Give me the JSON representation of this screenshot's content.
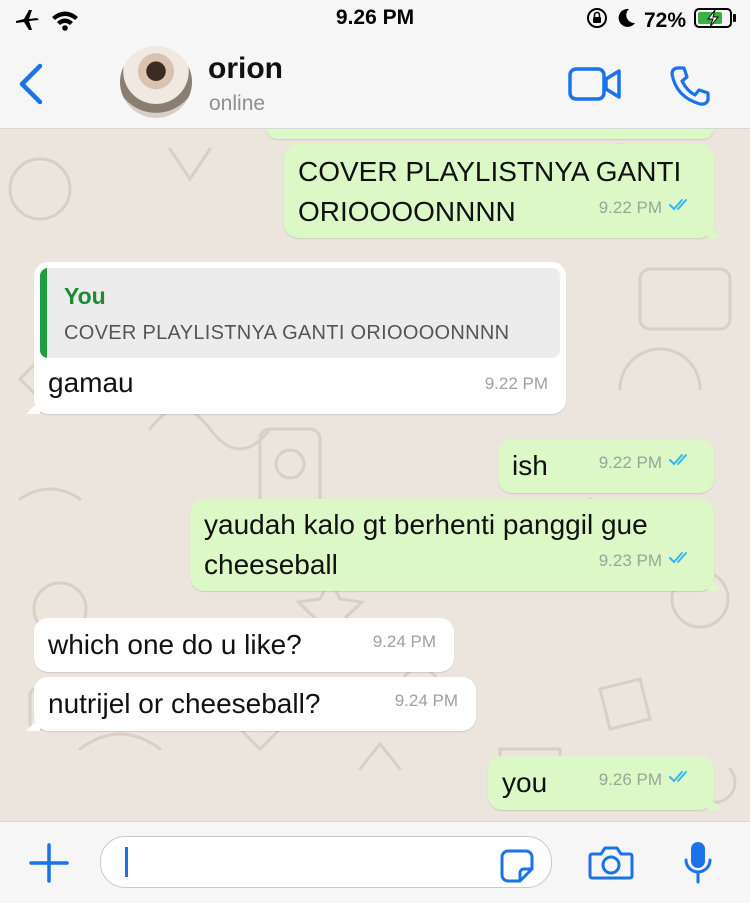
{
  "status_bar": {
    "time": "9.26 PM",
    "battery": "72%",
    "icons": [
      "airplane-icon",
      "wifi-icon",
      "orientation-lock-icon",
      "moon-icon",
      "battery-charging-icon"
    ]
  },
  "header": {
    "contact_name": "orion",
    "contact_status": "online",
    "icons": [
      "chevron-left-icon",
      "video-camera-icon",
      "phone-icon"
    ]
  },
  "colors": {
    "accent": "#1a73e8",
    "outgoing_bubble": "#dcf8c6",
    "incoming_bubble": "#ffffff",
    "read_ticks": "#34b7f1",
    "chat_background": "#ece5dd",
    "quote_author": "#1f8a32"
  },
  "messages": [
    {
      "direction": "out",
      "text": "COVER PLAYLISTNYA GANTI ORIOOOONNNN",
      "time": "9.22 PM",
      "read": true
    },
    {
      "direction": "in",
      "reply_to": {
        "author": "You",
        "text": "COVER PLAYLISTNYA GANTI ORIOOOONNNN"
      },
      "text": "gamau",
      "time": "9.22 PM"
    },
    {
      "direction": "out",
      "text": "ish",
      "time": "9.22 PM",
      "read": true
    },
    {
      "direction": "out",
      "text": "yaudah kalo gt berhenti panggil gue cheeseball",
      "time": "9.23 PM",
      "read": true
    },
    {
      "direction": "in",
      "text": "which one do u like?",
      "time": "9.24 PM"
    },
    {
      "direction": "in",
      "text": "nutrijel or cheeseball?",
      "time": "9.24 PM"
    },
    {
      "direction": "out",
      "text": "you",
      "time": "9.26 PM",
      "read": true
    }
  ],
  "composer": {
    "input_value": "",
    "icons": [
      "plus-icon",
      "sticker-icon",
      "camera-icon",
      "microphone-icon"
    ]
  }
}
